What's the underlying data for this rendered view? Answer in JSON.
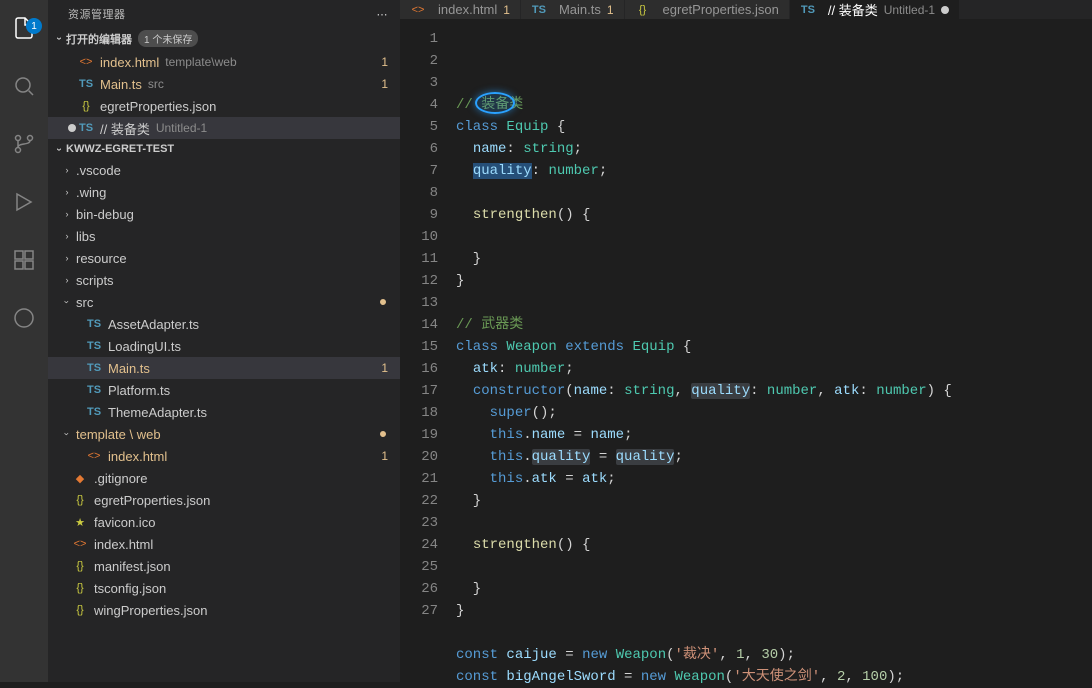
{
  "activity": {
    "explorer_badge": "1"
  },
  "sidebar": {
    "title": "资源管理器",
    "open_editors": {
      "label": "打开的编辑器",
      "unsaved": "1 个未保存",
      "items": [
        {
          "icon": "html",
          "name": "index.html",
          "path": "template\\web",
          "count": "1"
        },
        {
          "icon": "ts",
          "name": "Main.ts",
          "path": "src",
          "count": "1"
        },
        {
          "icon": "json",
          "name": "egretProperties.json",
          "path": "",
          "count": ""
        },
        {
          "icon": "ts",
          "name": "// 装备类",
          "path": "Untitled-1",
          "count": "",
          "dirty": true
        }
      ]
    },
    "project": "KWWZ-EGRET-TEST",
    "tree": [
      {
        "type": "folder",
        "name": ".vscode",
        "indent": 1
      },
      {
        "type": "folder",
        "name": ".wing",
        "indent": 1
      },
      {
        "type": "folder",
        "name": "bin-debug",
        "indent": 1
      },
      {
        "type": "folder",
        "name": "libs",
        "indent": 1
      },
      {
        "type": "folder",
        "name": "resource",
        "indent": 1
      },
      {
        "type": "folder",
        "name": "scripts",
        "indent": 1
      },
      {
        "type": "folder",
        "name": "src",
        "indent": 1,
        "open": true,
        "git": true
      },
      {
        "type": "file",
        "icon": "ts",
        "name": "AssetAdapter.ts",
        "indent": 2
      },
      {
        "type": "file",
        "icon": "ts",
        "name": "LoadingUI.ts",
        "indent": 2
      },
      {
        "type": "file",
        "icon": "ts",
        "name": "Main.ts",
        "indent": 2,
        "selected": true,
        "count": "1",
        "git_m": true
      },
      {
        "type": "file",
        "icon": "ts",
        "name": "Platform.ts",
        "indent": 2
      },
      {
        "type": "file",
        "icon": "ts",
        "name": "ThemeAdapter.ts",
        "indent": 2
      },
      {
        "type": "folder",
        "name": "template \\ web",
        "indent": 1,
        "open": true,
        "git": true,
        "git_m": true
      },
      {
        "type": "file",
        "icon": "html",
        "name": "index.html",
        "indent": 2,
        "count": "1",
        "git_m": true
      },
      {
        "type": "file",
        "icon": "gitignore",
        "name": ".gitignore",
        "indent": 1
      },
      {
        "type": "file",
        "icon": "json",
        "name": "egretProperties.json",
        "indent": 1
      },
      {
        "type": "file",
        "icon": "star",
        "name": "favicon.ico",
        "indent": 1
      },
      {
        "type": "file",
        "icon": "html",
        "name": "index.html",
        "indent": 1
      },
      {
        "type": "file",
        "icon": "json",
        "name": "manifest.json",
        "indent": 1
      },
      {
        "type": "file",
        "icon": "json",
        "name": "tsconfig.json",
        "indent": 1
      },
      {
        "type": "file",
        "icon": "json",
        "name": "wingProperties.json",
        "indent": 1
      }
    ]
  },
  "tabs": [
    {
      "icon": "html",
      "label": "index.html",
      "mod": "1"
    },
    {
      "icon": "ts",
      "label": "Main.ts",
      "mod": "1"
    },
    {
      "icon": "json",
      "label": "egretProperties.json",
      "mod": ""
    },
    {
      "icon": "ts",
      "label": "// 装备类",
      "path": "Untitled-1",
      "active": true,
      "dirty": true
    }
  ],
  "code": {
    "lines": [
      {
        "n": 1,
        "t": [
          [
            "comment",
            "// 装备类"
          ]
        ]
      },
      {
        "n": 2,
        "t": [
          [
            "keyword",
            "class"
          ],
          [
            "punct",
            " "
          ],
          [
            "type",
            "Equip"
          ],
          [
            "punct",
            " {"
          ]
        ]
      },
      {
        "n": 3,
        "t": [
          [
            "punct",
            "  "
          ],
          [
            "ident",
            "name"
          ],
          [
            "punct",
            ": "
          ],
          [
            "type",
            "string"
          ],
          [
            "punct",
            ";"
          ]
        ]
      },
      {
        "n": 4,
        "t": [
          [
            "punct",
            "  "
          ],
          [
            "sel",
            "quality"
          ],
          [
            "punct",
            ": "
          ],
          [
            "type",
            "number"
          ],
          [
            "punct",
            ";"
          ]
        ]
      },
      {
        "n": 5,
        "t": [
          [
            "punct",
            ""
          ]
        ]
      },
      {
        "n": 6,
        "t": [
          [
            "punct",
            "  "
          ],
          [
            "func",
            "strengthen"
          ],
          [
            "punct",
            "() {"
          ]
        ]
      },
      {
        "n": 7,
        "t": [
          [
            "punct",
            ""
          ]
        ]
      },
      {
        "n": 8,
        "t": [
          [
            "punct",
            "  }"
          ]
        ]
      },
      {
        "n": 9,
        "t": [
          [
            "punct",
            "}"
          ]
        ]
      },
      {
        "n": 10,
        "t": [
          [
            "punct",
            ""
          ]
        ]
      },
      {
        "n": 11,
        "t": [
          [
            "comment",
            "// 武器类"
          ]
        ]
      },
      {
        "n": 12,
        "t": [
          [
            "keyword",
            "class"
          ],
          [
            "punct",
            " "
          ],
          [
            "type",
            "Weapon"
          ],
          [
            "punct",
            " "
          ],
          [
            "keyword",
            "extends"
          ],
          [
            "punct",
            " "
          ],
          [
            "type",
            "Equip"
          ],
          [
            "punct",
            " {"
          ]
        ]
      },
      {
        "n": 13,
        "t": [
          [
            "punct",
            "  "
          ],
          [
            "ident",
            "atk"
          ],
          [
            "punct",
            ": "
          ],
          [
            "type",
            "number"
          ],
          [
            "punct",
            ";"
          ]
        ]
      },
      {
        "n": 14,
        "t": [
          [
            "punct",
            "  "
          ],
          [
            "keyword",
            "constructor"
          ],
          [
            "punct",
            "("
          ],
          [
            "param",
            "name"
          ],
          [
            "punct",
            ": "
          ],
          [
            "type",
            "string"
          ],
          [
            "punct",
            ", "
          ],
          [
            "hl",
            "quality"
          ],
          [
            "punct",
            ": "
          ],
          [
            "type",
            "number"
          ],
          [
            "punct",
            ", "
          ],
          [
            "param",
            "atk"
          ],
          [
            "punct",
            ": "
          ],
          [
            "type",
            "number"
          ],
          [
            "punct",
            ") {"
          ]
        ]
      },
      {
        "n": 15,
        "t": [
          [
            "punct",
            "    "
          ],
          [
            "keyword",
            "super"
          ],
          [
            "punct",
            "();"
          ]
        ]
      },
      {
        "n": 16,
        "t": [
          [
            "punct",
            "    "
          ],
          [
            "keyword",
            "this"
          ],
          [
            "punct",
            "."
          ],
          [
            "ident",
            "name"
          ],
          [
            "punct",
            " = "
          ],
          [
            "ident",
            "name"
          ],
          [
            "punct",
            ";"
          ]
        ]
      },
      {
        "n": 17,
        "t": [
          [
            "punct",
            "    "
          ],
          [
            "keyword",
            "this"
          ],
          [
            "punct",
            "."
          ],
          [
            "hl",
            "quality"
          ],
          [
            "punct",
            " = "
          ],
          [
            "hl",
            "quality"
          ],
          [
            "punct",
            ";"
          ]
        ]
      },
      {
        "n": 18,
        "t": [
          [
            "punct",
            "    "
          ],
          [
            "keyword",
            "this"
          ],
          [
            "punct",
            "."
          ],
          [
            "ident",
            "atk"
          ],
          [
            "punct",
            " = "
          ],
          [
            "ident",
            "atk"
          ],
          [
            "punct",
            ";"
          ]
        ]
      },
      {
        "n": 19,
        "t": [
          [
            "punct",
            "  }"
          ]
        ]
      },
      {
        "n": 20,
        "t": [
          [
            "punct",
            ""
          ]
        ]
      },
      {
        "n": 21,
        "t": [
          [
            "punct",
            "  "
          ],
          [
            "func",
            "strengthen"
          ],
          [
            "punct",
            "() {"
          ]
        ]
      },
      {
        "n": 22,
        "t": [
          [
            "punct",
            ""
          ]
        ]
      },
      {
        "n": 23,
        "t": [
          [
            "punct",
            "  }"
          ]
        ]
      },
      {
        "n": 24,
        "t": [
          [
            "punct",
            "}"
          ]
        ]
      },
      {
        "n": 25,
        "t": [
          [
            "punct",
            ""
          ]
        ]
      },
      {
        "n": 26,
        "t": [
          [
            "keyword",
            "const"
          ],
          [
            "punct",
            " "
          ],
          [
            "ident",
            "caijue"
          ],
          [
            "punct",
            " = "
          ],
          [
            "keyword",
            "new"
          ],
          [
            "punct",
            " "
          ],
          [
            "type",
            "Weapon"
          ],
          [
            "punct",
            "("
          ],
          [
            "string",
            "'裁决'"
          ],
          [
            "punct",
            ", "
          ],
          [
            "number",
            "1"
          ],
          [
            "punct",
            ", "
          ],
          [
            "number",
            "30"
          ],
          [
            "punct",
            ");"
          ]
        ]
      },
      {
        "n": 27,
        "t": [
          [
            "keyword",
            "const"
          ],
          [
            "punct",
            " "
          ],
          [
            "ident",
            "bigAngelSword"
          ],
          [
            "punct",
            " = "
          ],
          [
            "keyword",
            "new"
          ],
          [
            "punct",
            " "
          ],
          [
            "type",
            "Weapon"
          ],
          [
            "punct",
            "("
          ],
          [
            "string",
            "'大天使之剑'"
          ],
          [
            "punct",
            ", "
          ],
          [
            "number",
            "2"
          ],
          [
            "punct",
            ", "
          ],
          [
            "number",
            "100"
          ],
          [
            "punct",
            ");"
          ]
        ]
      }
    ]
  }
}
